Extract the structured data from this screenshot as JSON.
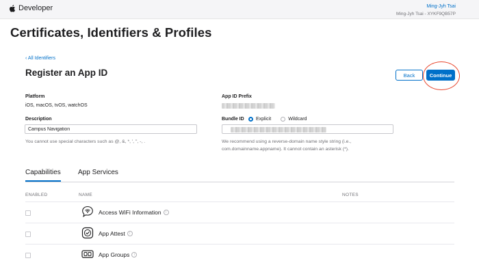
{
  "header": {
    "brand": "Developer",
    "account_name": "Ming-Jyh Tsai",
    "account_team": "Ming-Jyh Tsai - XYKF9QB57P"
  },
  "page": {
    "title": "Certificates, Identifiers & Profiles",
    "back_link": "‹ All Identifiers",
    "section_title": "Register an App ID",
    "back_button": "Back",
    "continue_button": "Continue"
  },
  "form": {
    "platform_label": "Platform",
    "platform_value": "iOS, macOS, tvOS, watchOS",
    "description_label": "Description",
    "description_value": "Campus Navigation",
    "description_help": "You cannot use special characters such as @, &, *, ', \", -, .",
    "prefix_label": "App ID Prefix",
    "bundle_label": "Bundle ID",
    "bundle_options": [
      "Explicit",
      "Wildcard"
    ],
    "bundle_selected": "Explicit",
    "bundle_help_line1": "We recommend using a reverse-domain name style string (i.e.,",
    "bundle_help_line2": "com.domainname.appname). It cannot contain an asterisk (*)."
  },
  "tabs": [
    "Capabilities",
    "App Services"
  ],
  "columns": {
    "enabled": "ENABLED",
    "name": "NAME",
    "notes": "NOTES"
  },
  "capabilities": [
    {
      "name": "Access WiFi Information",
      "icon": "wifi-bubble-icon"
    },
    {
      "name": "App Attest",
      "icon": "app-attest-icon"
    },
    {
      "name": "App Groups",
      "icon": "app-groups-icon"
    }
  ],
  "accent_color": "#0070c9",
  "highlight_color": "#e8472e"
}
